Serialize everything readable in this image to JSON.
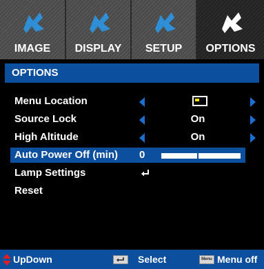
{
  "tabs": [
    {
      "label": "IMAGE",
      "icon": "puzzle-icon",
      "active": false
    },
    {
      "label": "DISPLAY",
      "icon": "puzzle-icon",
      "active": false
    },
    {
      "label": "SETUP",
      "icon": "puzzle-icon",
      "active": false
    },
    {
      "label": "OPTIONS",
      "icon": "puzzle-icon",
      "active": true
    }
  ],
  "header": {
    "title": "OPTIONS"
  },
  "menu": [
    {
      "label": "Menu Location",
      "value_icon": "menu-location-icon"
    },
    {
      "label": "Source Lock",
      "value": "On"
    },
    {
      "label": "High Altitude",
      "value": "On"
    },
    {
      "label": "Auto Power Off (min)",
      "value": "0",
      "slider_level": 0.45
    },
    {
      "label": "Lamp Settings",
      "value_icon": "enter-icon"
    },
    {
      "label": "Reset"
    }
  ],
  "footer": {
    "updown": "UpDown",
    "select_key": "enter-key-icon",
    "select": "Select",
    "menu_key": "Menu",
    "menuoff": "Menu off"
  },
  "colors": {
    "accent": "#0b4f9e",
    "arrow": "#1a6fd1",
    "icon_blue": "#2f8fd6",
    "updown": "#e02020"
  }
}
